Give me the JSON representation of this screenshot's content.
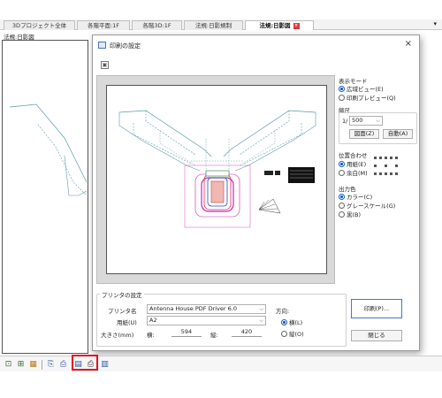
{
  "tabs": [
    {
      "label": "3Dプロジェクト全体",
      "active": false
    },
    {
      "label": "各階平面:1F",
      "active": false
    },
    {
      "label": "各階3D:1F",
      "active": false
    },
    {
      "label": "法規:日影規制",
      "active": false
    },
    {
      "label": "法規:日影図",
      "active": true
    }
  ],
  "tab_close_glyph": "×",
  "tabbar_dropdown_glyph": "▾",
  "document_title": "法規:日影図",
  "dialog": {
    "title": "印刷の設定",
    "close_glyph": "×",
    "display_mode": {
      "label": "表示モード",
      "options": [
        {
          "label": "広域ビュー(E)",
          "selected": true
        },
        {
          "label": "印刷プレビュー(Q)",
          "selected": false
        }
      ]
    },
    "scale": {
      "label": "縮尺",
      "prefix": "1/",
      "value": "500",
      "fit_button": "図面(Z)",
      "auto_button": "自動(A)"
    },
    "alignment": {
      "label": "位置合わせ",
      "options": [
        {
          "label": "用紙(E)",
          "selected": true
        },
        {
          "label": "余白(M)",
          "selected": false
        }
      ]
    },
    "output_color": {
      "label": "出力色",
      "options": [
        {
          "label": "カラー(C)",
          "selected": true
        },
        {
          "label": "グレースケール(G)",
          "selected": false
        },
        {
          "label": "黒(B)",
          "selected": false
        }
      ]
    },
    "printer": {
      "section_label": "プリンタの設定",
      "name_label": "プリンタ名",
      "name_value": "Antenna House PDF Driver 6.0",
      "paper_label": "用紙(U)",
      "paper_value": "A2",
      "size_label": "大きさ(mm)",
      "width_label": "横:",
      "width_value": "594",
      "height_label": "縦:",
      "height_value": "420",
      "orientation_label": "方向:",
      "orientation_options": [
        {
          "label": "横(L)",
          "selected": true
        },
        {
          "label": "縦(O)",
          "selected": false
        }
      ]
    },
    "print_button": "印刷(P)...",
    "close_button": "閉じる"
  },
  "colors": {
    "accent": "#1b5fbf",
    "highlight": "#e01020",
    "tab_close": "#e0353b",
    "drawing_cyan": "#5a9ba8",
    "drawing_magenta": "#d020c0"
  }
}
